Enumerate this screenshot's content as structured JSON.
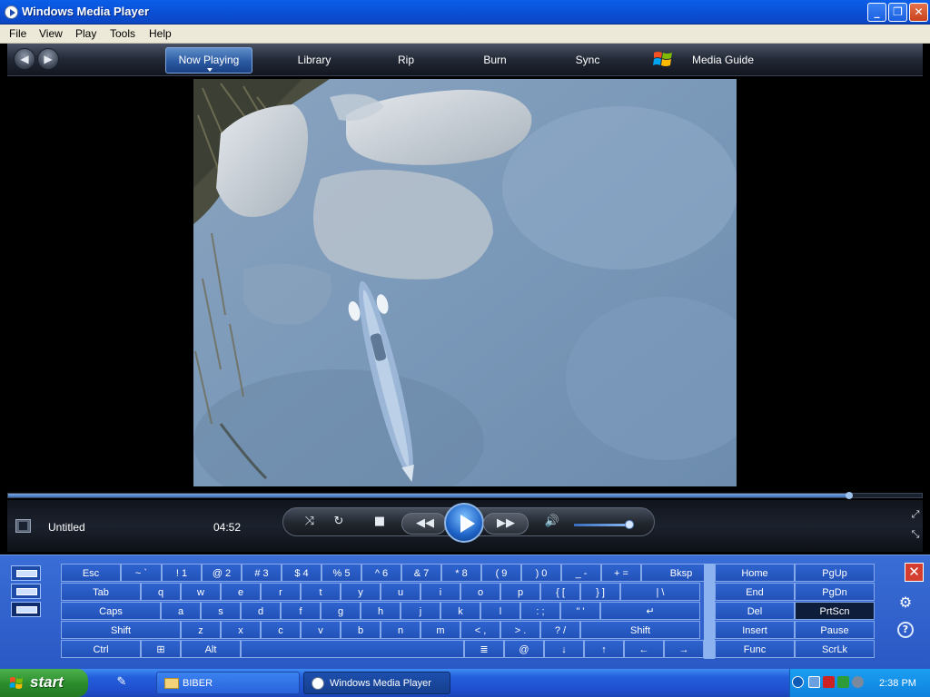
{
  "window": {
    "title": "Windows Media Player",
    "controls": {
      "minimize": "_",
      "restore": "❐",
      "close": "✕"
    }
  },
  "menubar": {
    "items": [
      "File",
      "View",
      "Play",
      "Tools",
      "Help"
    ]
  },
  "nav": {
    "tabs": [
      {
        "label": "Now Playing",
        "active": true
      },
      {
        "label": "Library"
      },
      {
        "label": "Rip"
      },
      {
        "label": "Burn"
      },
      {
        "label": "Sync"
      },
      {
        "label": "Media Guide"
      }
    ]
  },
  "player": {
    "media_title": "Untitled",
    "time": "04:52",
    "seek_progress": 0.92,
    "volume_level": 0.95
  },
  "osk": {
    "rows": [
      [
        [
          "Esc"
        ],
        [
          "~ `"
        ],
        [
          "! 1"
        ],
        [
          "@ 2"
        ],
        [
          "# 3"
        ],
        [
          "$ 4"
        ],
        [
          "% 5"
        ],
        [
          "^ 6"
        ],
        [
          "& 7"
        ],
        [
          "* 8"
        ],
        [
          "( 9"
        ],
        [
          ") 0"
        ],
        [
          "_ -"
        ],
        [
          "+ ="
        ],
        [
          "Bksp"
        ]
      ],
      [
        [
          "Tab"
        ],
        [
          "q"
        ],
        [
          "w"
        ],
        [
          "e"
        ],
        [
          "r"
        ],
        [
          "t"
        ],
        [
          "y"
        ],
        [
          "u"
        ],
        [
          "i"
        ],
        [
          "o"
        ],
        [
          "p"
        ],
        [
          "{ ["
        ],
        [
          "} ]"
        ],
        [
          "| \\"
        ]
      ],
      [
        [
          "Caps"
        ],
        [
          "a"
        ],
        [
          "s"
        ],
        [
          "d"
        ],
        [
          "f"
        ],
        [
          "g"
        ],
        [
          "h"
        ],
        [
          "j"
        ],
        [
          "k"
        ],
        [
          "l"
        ],
        [
          ": ;"
        ],
        [
          "\" '"
        ],
        [
          "↵"
        ]
      ],
      [
        [
          "Shift"
        ],
        [
          "z"
        ],
        [
          "x"
        ],
        [
          "c"
        ],
        [
          "v"
        ],
        [
          "b"
        ],
        [
          "n"
        ],
        [
          "m"
        ],
        [
          "< ,"
        ],
        [
          "> ."
        ],
        [
          "? /"
        ],
        [
          "Shift"
        ]
      ],
      [
        [
          "Ctrl"
        ],
        [
          "⊞"
        ],
        [
          "Alt"
        ],
        [
          ""
        ],
        [
          "≣"
        ],
        [
          "@"
        ],
        [
          "↓"
        ],
        [
          "↑"
        ],
        [
          "←"
        ],
        [
          "→"
        ]
      ]
    ],
    "nav_keys": [
      [
        "Home",
        "PgUp"
      ],
      [
        "End",
        "PgDn"
      ],
      [
        "Del",
        "PrtScn"
      ],
      [
        "Insert",
        "Pause"
      ],
      [
        "Func",
        "ScrLk"
      ]
    ],
    "close_label": "✕",
    "settings_label": "⚙",
    "help_label": "?"
  },
  "taskbar": {
    "start_label": "start",
    "tasks": [
      "BIBER",
      "Windows Media Player"
    ],
    "clock": "2:38 PM"
  }
}
